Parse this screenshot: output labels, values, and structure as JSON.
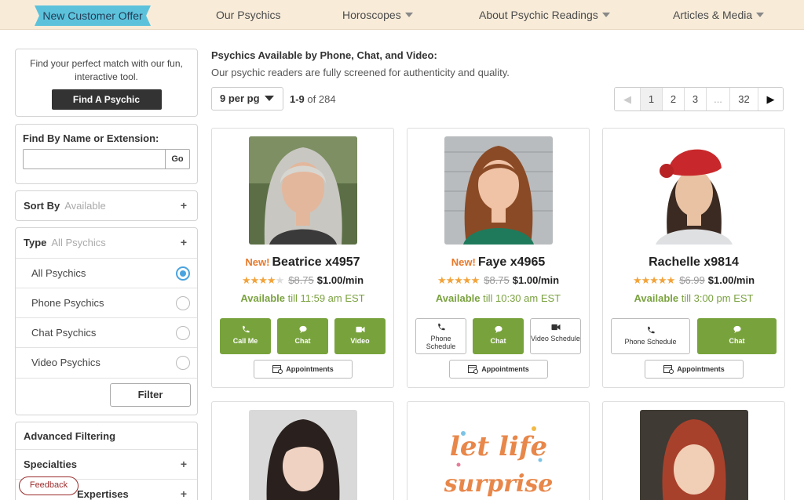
{
  "nav": {
    "offer": "New Customer Offer",
    "items": [
      {
        "label": "Our Psychics",
        "has_dropdown": false
      },
      {
        "label": "Horoscopes",
        "has_dropdown": true
      },
      {
        "label": "About Psychic Readings",
        "has_dropdown": true
      },
      {
        "label": "Articles & Media",
        "has_dropdown": true
      }
    ]
  },
  "sidebar": {
    "match_text": "Find your perfect match with our fun, interactive tool.",
    "find_button": "Find A Psychic",
    "search_title": "Find By Name or Extension:",
    "search_value": "",
    "go_button": "Go",
    "sort_label": "Sort By",
    "sort_value": "Available",
    "type_label": "Type",
    "type_value": "All Psychics",
    "type_options": [
      {
        "label": "All Psychics",
        "selected": true
      },
      {
        "label": "Phone Psychics",
        "selected": false
      },
      {
        "label": "Chat Psychics",
        "selected": false
      },
      {
        "label": "Video Psychics",
        "selected": false
      }
    ],
    "filter_button": "Filter",
    "advanced_label": "Advanced Filtering",
    "specialties_label": "Specialties",
    "expertises_label": "Expertises",
    "feedback": "Feedback"
  },
  "main": {
    "heading": "Psychics Available by Phone, Chat, and Video:",
    "subheading": "Our psychic readers are fully screened for authenticity and quality.",
    "per_page": "9 per pg",
    "range_bold": "1-9",
    "range_rest": " of 284",
    "pages": [
      "1",
      "2",
      "3",
      "...",
      "32"
    ]
  },
  "psychics": [
    {
      "new_label": "New!",
      "name": "Beatrice x4957",
      "stars": 4,
      "old_price": "$8.75",
      "price": "$1.00/min",
      "available": "Available",
      "available_rest": " till 11:59 am EST",
      "buttons": [
        {
          "label": "Call Me",
          "icon": "phone-icon",
          "style": "green"
        },
        {
          "label": "Chat",
          "icon": "chat-icon",
          "style": "green"
        },
        {
          "label": "Video",
          "icon": "video-icon",
          "style": "green"
        }
      ],
      "appointments": "Appointments"
    },
    {
      "new_label": "New!",
      "name": "Faye x4965",
      "stars": 5,
      "old_price": "$8.75",
      "price": "$1.00/min",
      "available": "Available",
      "available_rest": " till 10:30 am EST",
      "buttons": [
        {
          "label": "Phone Schedule",
          "icon": "phone-icon",
          "style": "white"
        },
        {
          "label": "Chat",
          "icon": "chat-icon",
          "style": "green"
        },
        {
          "label": "Video Schedule",
          "icon": "video-icon",
          "style": "white"
        }
      ],
      "appointments": "Appointments"
    },
    {
      "new_label": "",
      "name": "Rachelle x9814",
      "stars": 5,
      "old_price": "$6.99",
      "price": "$1.00/min",
      "available": "Available",
      "available_rest": " till 3:00 pm EST",
      "buttons": [
        {
          "label": "Phone Schedule",
          "icon": "phone-icon",
          "style": "white"
        },
        {
          "label": "Chat",
          "icon": "chat-icon",
          "style": "green"
        }
      ],
      "appointments": "Appointments"
    }
  ],
  "second_row": {
    "middle_art_text": [
      "let life",
      "surprise"
    ]
  },
  "colors": {
    "nav_bg": "#f8ecd9",
    "offer_bg": "#5cc2db",
    "green": "#78a33c",
    "new_orange": "#e8792b",
    "star": "#f2a33a"
  }
}
